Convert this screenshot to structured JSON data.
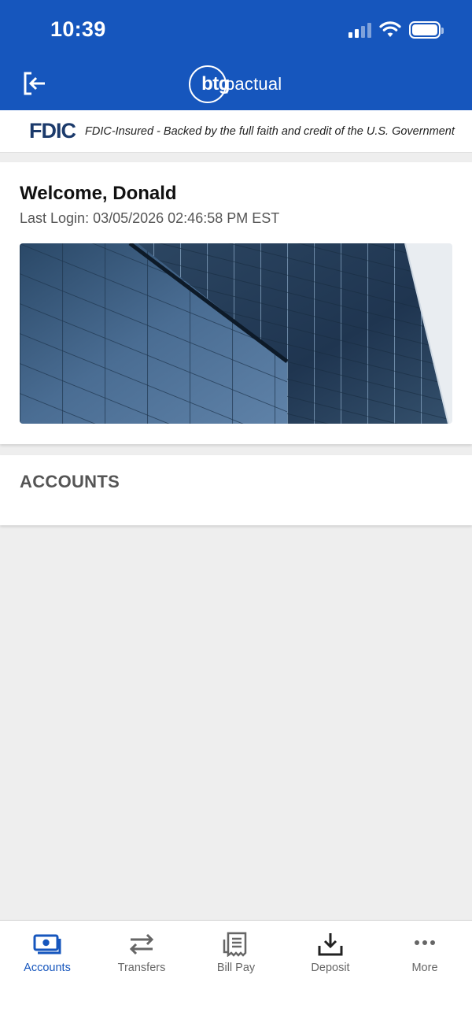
{
  "status_bar": {
    "time": "10:39",
    "icons": [
      "signal-icon",
      "wifi-icon",
      "battery-icon"
    ]
  },
  "header": {
    "logout_icon": "logout-icon",
    "logo": {
      "mark": "btg",
      "wordmark": "pactual"
    },
    "background_color": "#1656bd"
  },
  "fdic": {
    "logo_text": "FDIC",
    "text": "FDIC-Insured - Backed by the full faith and credit of the U.S. Government"
  },
  "welcome": {
    "title": "Welcome, Donald",
    "last_login": "Last Login: 03/05/2026 02:46:58 PM EST"
  },
  "accounts": {
    "title": "ACCOUNTS"
  },
  "tabs": [
    {
      "label": "Accounts",
      "icon": "accounts-icon",
      "active": true
    },
    {
      "label": "Transfers",
      "icon": "transfers-icon",
      "active": false
    },
    {
      "label": "Bill Pay",
      "icon": "bill-pay-icon",
      "active": false
    },
    {
      "label": "Deposit",
      "icon": "deposit-icon",
      "active": false
    },
    {
      "label": "More",
      "icon": "more-icon",
      "active": false
    }
  ],
  "colors": {
    "accent": "#1656bd",
    "inactive_tab": "#666666",
    "fdic_navy": "#1b3a6b"
  }
}
